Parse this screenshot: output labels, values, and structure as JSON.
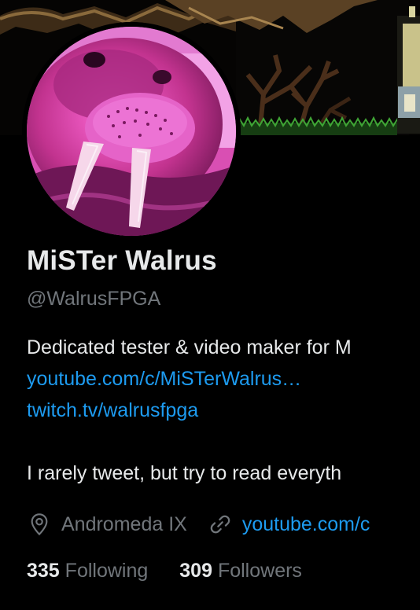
{
  "profile": {
    "display_name": "MiSTer Walrus",
    "handle": "@WalrusFPGA"
  },
  "bio": {
    "line1": "Dedicated tester & video maker for M",
    "link1": "youtube.com/c/MiSTerWalrus…",
    "link2": "twitch.tv/walrusfpga",
    "line4": "I rarely tweet, but try to read everyth"
  },
  "meta": {
    "location": "Andromeda IX",
    "website": "youtube.com/c"
  },
  "stats": {
    "following_count": "335",
    "following_label": "Following",
    "followers_count": "309",
    "followers_label": "Followers"
  },
  "icons": {
    "location": "map-pin-icon",
    "website": "link-icon"
  },
  "colors": {
    "background": "#000000",
    "text_primary": "#e7e9ea",
    "text_secondary": "#71767b",
    "link": "#1d9bf0"
  }
}
